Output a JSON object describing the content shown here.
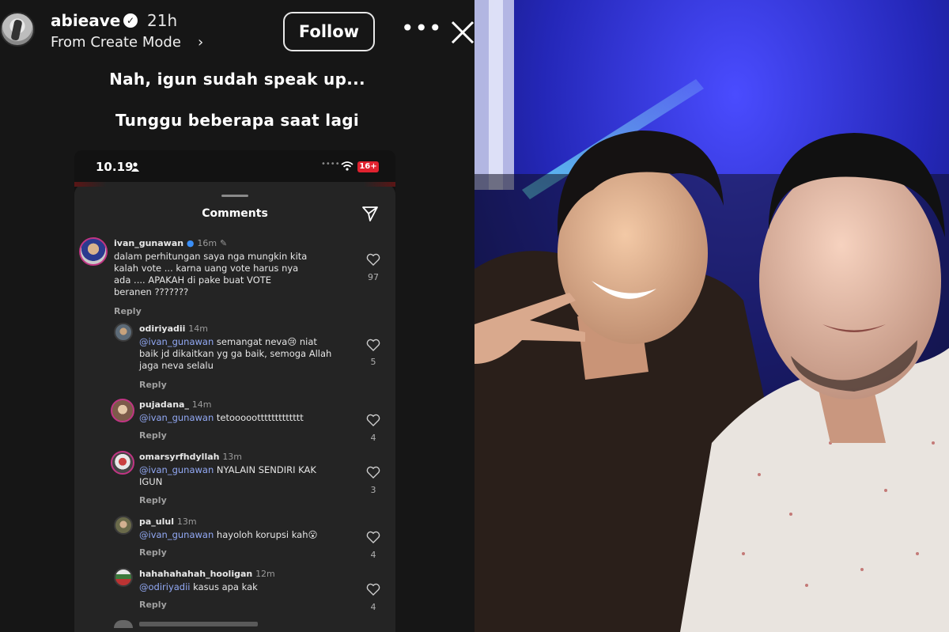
{
  "story": {
    "username": "abieave",
    "verified_icon": "verified-badge-icon",
    "age": "21h",
    "subtitle": "From Create Mode",
    "follow_label": "Follow",
    "more_icon": "more-horizontal-icon",
    "close_icon": "close-icon",
    "caption_line1": "Nah, igun sudah speak up...",
    "caption_line2": "Tunggu beberapa saat lagi"
  },
  "embedded_screenshot": {
    "status_time": "10.19",
    "battery_label": "16+",
    "comments_title": "Comments",
    "comments": [
      {
        "user": "ivan_gunawan",
        "time": "16m",
        "text": "dalam perhitungan saya nga mungkin kita\nkalah vote ... karna uang vote harus nya\nada .... APAKAH di pake buat VOTE\nberanen ???????",
        "likes": "97",
        "reply_label": "Reply"
      },
      {
        "user": "odiriyadii",
        "time": "14m",
        "mention": "@ivan_gunawan",
        "text": " semangat neva😢 niat\nbaik jd dikaitkan yg ga baik, semoga Allah\njaga neva selalu",
        "likes": "5",
        "reply_label": "Reply"
      },
      {
        "user": "pujadana_",
        "time": "14m",
        "mention": "@ivan_gunawan",
        "text": " tetooooottttttttttttt",
        "likes": "4",
        "reply_label": "Reply"
      },
      {
        "user": "omarsyrfhdyllah",
        "time": "13m",
        "mention": "@ivan_gunawan",
        "text": " NYALAIN SENDIRI KAK\nIGUN",
        "likes": "3",
        "reply_label": "Reply"
      },
      {
        "user": "pa_ulul",
        "time": "13m",
        "mention": "@ivan_gunawan",
        "text": " hayoloh korupsi kah😮",
        "likes": "4",
        "reply_label": "Reply"
      },
      {
        "user": "hahahahahah_hooligan",
        "time": "12m",
        "mention": "@odiriyadii",
        "text": " kasus apa kak",
        "likes": "4",
        "reply_label": "Reply"
      }
    ]
  },
  "colors": {
    "story_bg": "#161616",
    "sheet_bg": "#242424",
    "mention": "#92a9f5",
    "battery_red": "#e0222f",
    "photo_glow": "#3a3cff"
  }
}
